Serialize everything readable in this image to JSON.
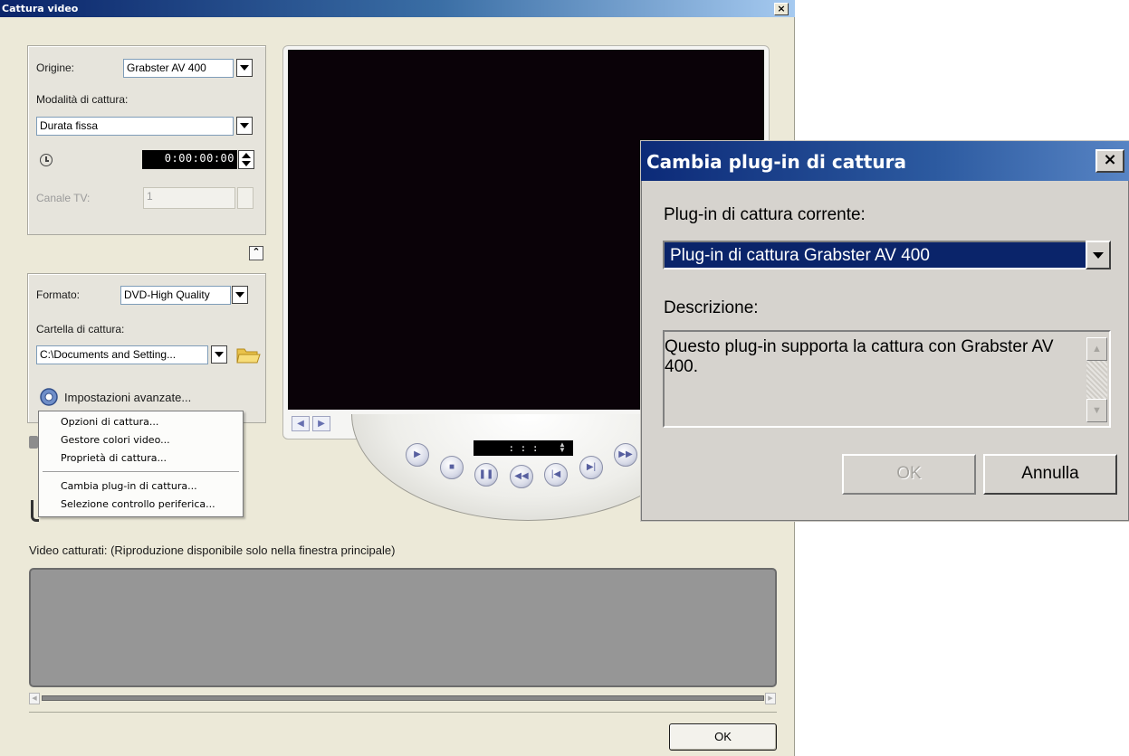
{
  "main_window": {
    "title": "Cattura video",
    "close_glyph": "×",
    "source_label": "Origine:",
    "source_value": "Grabster AV 400",
    "capture_mode_label": "Modalità di cattura:",
    "capture_mode_value": "Durata fissa",
    "duration_value": "0:00:00:00",
    "tv_channel_label": "Canale TV:",
    "tv_channel_value": "1",
    "format_label": "Formato:",
    "format_value": "DVD-High Quality",
    "folder_label": "Cartella di cattura:",
    "folder_value": "C:\\Documents and Setting...",
    "advanced_settings_label": "Impostazioni avanzate...",
    "captured_label": "Video catturati: (Riproduzione disponibile solo nella finestra principale)",
    "ok_label": "OK",
    "player_timecode": ": :  :"
  },
  "context_menu": {
    "items": [
      "Opzioni di cattura...",
      "Gestore colori video...",
      "Proprietà di cattura...",
      "Cambia plug-in di cattura...",
      "Selezione controllo periferica..."
    ]
  },
  "dialog": {
    "title": "Cambia plug-in di cattura",
    "close_glyph": "×",
    "current_plugin_label": "Plug-in di cattura corrente:",
    "current_plugin_value": "Plug-in di cattura Grabster AV 400",
    "description_label": "Descrizione:",
    "description_text": "Questo plug-in supporta la cattura con Grabster AV 400.",
    "ok_label": "OK",
    "cancel_label": "Annulla"
  },
  "colors": {
    "title_bar": "#0a246a",
    "selection": "#0a246a",
    "preview_screen": "#0a0208",
    "captured_area": "#969696"
  },
  "icons": [
    "clock-icon",
    "collapse-up-icon",
    "folder-icon",
    "advanced-settings-icon",
    "play-icon",
    "stop-icon",
    "pause-icon",
    "rewind-icon",
    "previous-frame-icon",
    "next-frame-icon",
    "fast-forward-icon"
  ]
}
